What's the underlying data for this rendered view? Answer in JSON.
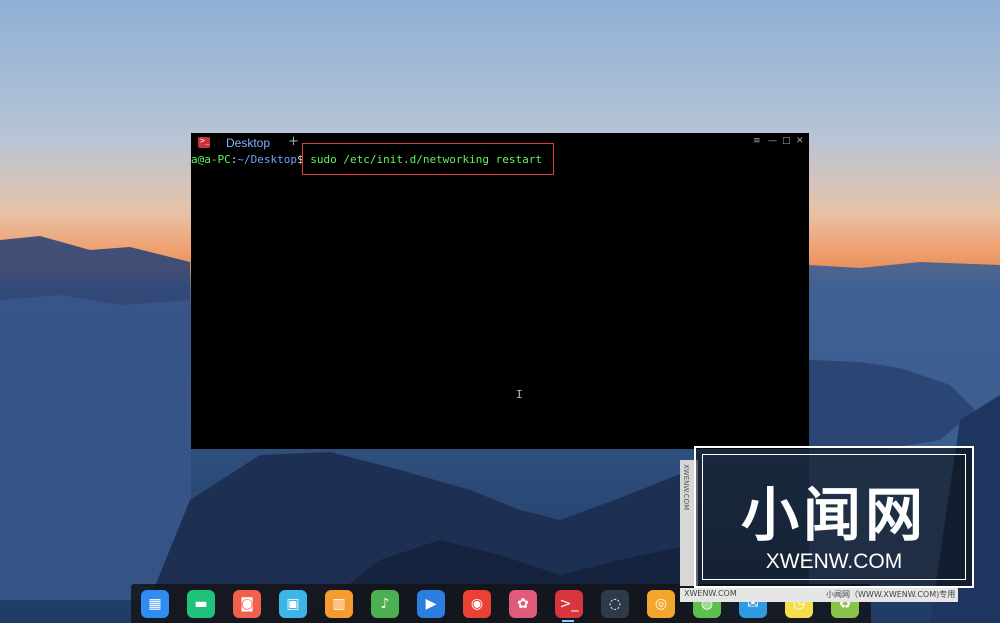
{
  "terminal": {
    "tab_label": "Desktop",
    "new_tab_symbol": "+",
    "window_controls": {
      "menu": "≡",
      "minimize": "—",
      "maximize": "□",
      "close": "✕"
    },
    "prompt": {
      "user": "a@a-PC",
      "separator": ":",
      "path": "~/Desktop",
      "dollar": "$",
      "command": " sudo /etc/init.d/networking restart"
    },
    "text_cursor": "I"
  },
  "watermark": {
    "title": "小闻网",
    "subtitle": "XWENW.COM",
    "side_text": "XWENW.COM",
    "bottom_left": "XWENW.COM",
    "bottom_right": "小闻网（WWW.XWENW.COM)专用"
  },
  "dock": {
    "items": [
      {
        "name": "launcher",
        "glyph": "▦",
        "color": "#2f8cf0"
      },
      {
        "name": "file-manager",
        "glyph": "▬",
        "color": "#1fc27a"
      },
      {
        "name": "screen-recorder",
        "glyph": "◙",
        "color": "#f0604c"
      },
      {
        "name": "app-store",
        "glyph": "▣",
        "color": "#3cb5e8"
      },
      {
        "name": "store-bag",
        "glyph": "▥",
        "color": "#f59b2f"
      },
      {
        "name": "music",
        "glyph": "♪",
        "color": "#4caf50"
      },
      {
        "name": "video-player",
        "glyph": "▶",
        "color": "#2a7de1"
      },
      {
        "name": "chrome",
        "glyph": "◉",
        "color": "#e94235"
      },
      {
        "name": "settings",
        "glyph": "✿",
        "color": "#e05a7a"
      },
      {
        "name": "terminal",
        "glyph": ">_",
        "color": "#d8363c"
      },
      {
        "name": "system-monitor",
        "glyph": "◌",
        "color": "#2d3a4a"
      },
      {
        "name": "camera",
        "glyph": "◎",
        "color": "#f2a62c"
      },
      {
        "name": "wechat",
        "glyph": "◍",
        "color": "#5cc14b"
      },
      {
        "name": "mail",
        "glyph": "✉",
        "color": "#2f9ae0"
      },
      {
        "name": "clock",
        "glyph": "◷",
        "color": "#f4e04a"
      },
      {
        "name": "trash",
        "glyph": "♻",
        "color": "#8bc34a"
      }
    ]
  }
}
